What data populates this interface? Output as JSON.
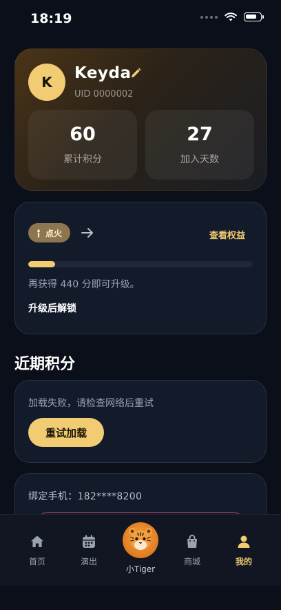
{
  "status_bar": {
    "time": "18:19"
  },
  "profile": {
    "avatar_letter": "K",
    "username": "Keyda",
    "uid": "UID 0000002",
    "stats": [
      {
        "value": "60",
        "label": "累计积分"
      },
      {
        "value": "27",
        "label": "加入天数"
      }
    ]
  },
  "level": {
    "badge_label": "点火",
    "benefits_link": "查看权益",
    "progress_fraction": 0.12,
    "upgrade_text": "再获得 440 分即可升级。",
    "unlock_title": "升级后解锁"
  },
  "recent_points": {
    "title": "近期积分",
    "error_text": "加载失败，请检查网络后重试",
    "retry_label": "重试加载"
  },
  "binding": {
    "phone_text": "绑定手机：182****8200"
  },
  "tabs": [
    {
      "label": "首页",
      "icon": "home-icon"
    },
    {
      "label": "演出",
      "icon": "calendar-icon"
    },
    {
      "label": "小Tiger",
      "icon": "tiger-icon"
    },
    {
      "label": "商城",
      "icon": "shopping-bag-icon"
    },
    {
      "label": "我的",
      "icon": "user-icon"
    }
  ],
  "colors": {
    "accent": "#f2cc73",
    "background": "#0b0f1a",
    "card": "#131a2a",
    "tab_active": "#f2cc73"
  }
}
